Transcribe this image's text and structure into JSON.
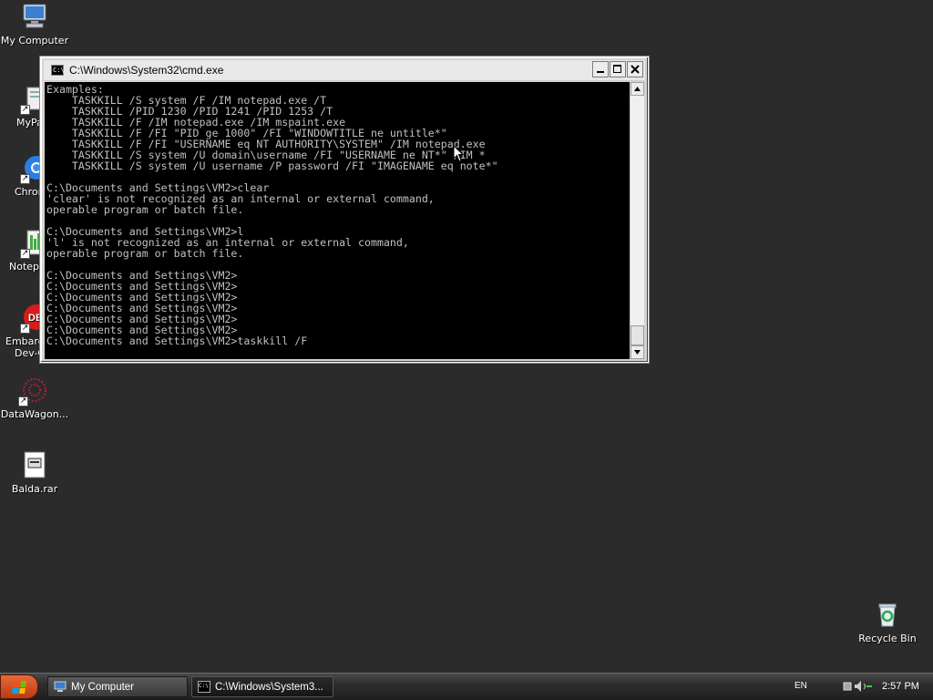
{
  "desktop": {
    "icons": [
      {
        "label": "My Computer",
        "icon": "my-computer-icon"
      },
      {
        "label": "MyPa",
        "icon": "mypa-icon"
      },
      {
        "label": "Chrom",
        "icon": "chrome-icon"
      },
      {
        "label": "Notepa",
        "icon": "notepad-icon"
      },
      {
        "label": "Embarca",
        "label2": "Dev-C",
        "icon_text": "DE",
        "icon": "embarcadero-dev-cpp-icon"
      },
      {
        "label": "DataWagon...",
        "icon": "datawagon-icon"
      },
      {
        "label": "Balda.rar",
        "icon": "rar-archive-icon"
      },
      {
        "label": "Recycle Bin",
        "icon": "recycle-bin-icon"
      }
    ]
  },
  "cmd_window": {
    "title": "C:\\Windows\\System32\\cmd.exe",
    "icon_text": "C:\\",
    "console_lines": [
      "Examples:",
      "    TASKKILL /S system /F /IM notepad.exe /T",
      "    TASKKILL /PID 1230 /PID 1241 /PID 1253 /T",
      "    TASKKILL /F /IM notepad.exe /IM mspaint.exe",
      "    TASKKILL /F /FI \"PID ge 1000\" /FI \"WINDOWTITLE ne untitle*\"",
      "    TASKKILL /F /FI \"USERNAME eq NT AUTHORITY\\SYSTEM\" /IM notepad.exe",
      "    TASKKILL /S system /U domain\\username /FI \"USERNAME ne NT*\" /IM *",
      "    TASKKILL /S system /U username /P password /FI \"IMAGENAME eq note*\"",
      "",
      "C:\\Documents and Settings\\VM2>clear",
      "'clear' is not recognized as an internal or external command,",
      "operable program or batch file.",
      "",
      "C:\\Documents and Settings\\VM2>l",
      "'l' is not recognized as an internal or external command,",
      "operable program or batch file.",
      "",
      "C:\\Documents and Settings\\VM2>",
      "C:\\Documents and Settings\\VM2>",
      "C:\\Documents and Settings\\VM2>",
      "C:\\Documents and Settings\\VM2>",
      "C:\\Documents and Settings\\VM2>",
      "C:\\Documents and Settings\\VM2>",
      "C:\\Documents and Settings\\VM2>taskkill /F"
    ],
    "scroll_position": 1.0
  },
  "taskbar": {
    "items": [
      {
        "label": "My Computer",
        "icon": "my-computer-icon",
        "active": false
      },
      {
        "label": "C:\\Windows\\System3...",
        "icon": "cmd-icon",
        "icon_text": "C:\\",
        "active": true
      }
    ],
    "language": "EN",
    "clock": "2:57 PM"
  }
}
